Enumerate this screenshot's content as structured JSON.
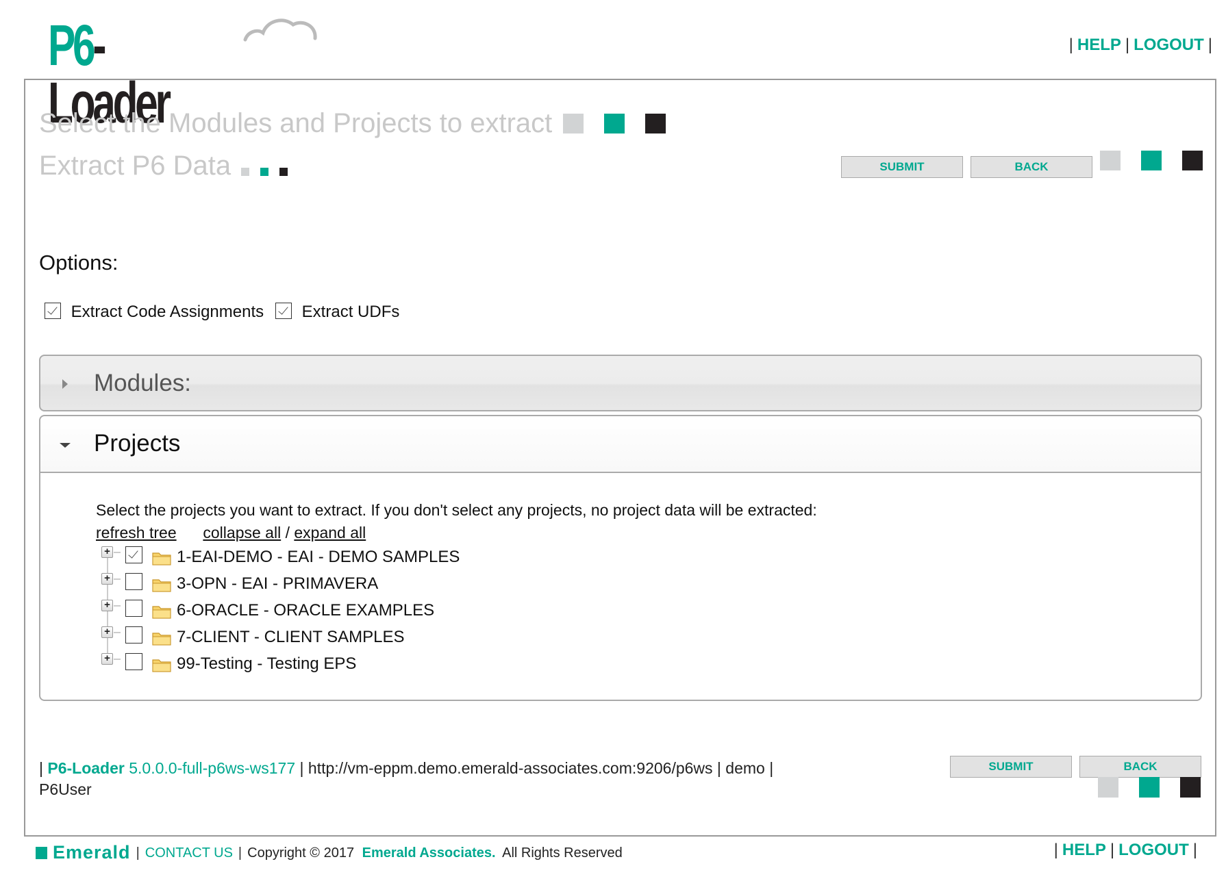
{
  "app": {
    "logo_part1": "P6",
    "logo_part2": "-Loader"
  },
  "header": {
    "help_label": "HELP",
    "logout_label": "LOGOUT",
    "separator": "|"
  },
  "page": {
    "title_primary": "Select the Modules and Projects to extract",
    "title_secondary": "Extract P6 Data"
  },
  "buttons": {
    "submit_label": "SUBMIT",
    "back_label": "BACK"
  },
  "colors": {
    "accent": "#00a88f",
    "gray_square": "#d1d3d4",
    "black_square": "#231f20"
  },
  "options": {
    "label": "Options:",
    "items": [
      {
        "label": "Extract Code Assignments",
        "checked": true
      },
      {
        "label": "Extract UDFs",
        "checked": true
      }
    ]
  },
  "panels": {
    "modules": {
      "title": "Modules:",
      "expanded": false
    },
    "projects": {
      "title": "Projects",
      "expanded": true
    }
  },
  "projects": {
    "intro": "Select the projects you want to extract. If you don't select any projects, no project data will be extracted:",
    "refresh_tree": "refresh tree",
    "collapse_all": "collapse all",
    "slash": "/",
    "expand_all": "expand all",
    "tree": [
      {
        "label": "1-EAI-DEMO - EAI - DEMO SAMPLES",
        "checked": true,
        "icon": "folder-icon"
      },
      {
        "label": "3-OPN - EAI - PRIMAVERA",
        "checked": false,
        "icon": "folder-icon"
      },
      {
        "label": "6-ORACLE - ORACLE EXAMPLES",
        "checked": false,
        "icon": "folder-icon"
      },
      {
        "label": "7-CLIENT - CLIENT SAMPLES",
        "checked": false,
        "icon": "folder-icon"
      },
      {
        "label": "99-Testing - Testing EPS",
        "checked": false,
        "icon": "folder-icon"
      }
    ]
  },
  "footer_info": {
    "sep": "|",
    "product": "P6-Loader",
    "version": "5.0.0.0-full-p6ws-ws177",
    "url": "http://vm-eppm.demo.emerald-associates.com:9206/p6ws",
    "database": "demo",
    "user": "P6User"
  },
  "bottom": {
    "brand": "Emerald",
    "contact_label": "CONTACT US",
    "copyright": "Copyright © 2017",
    "company": "Emerald Associates.",
    "rights": "All Rights Reserved",
    "help_label": "HELP",
    "logout_label": "LOGOUT"
  }
}
